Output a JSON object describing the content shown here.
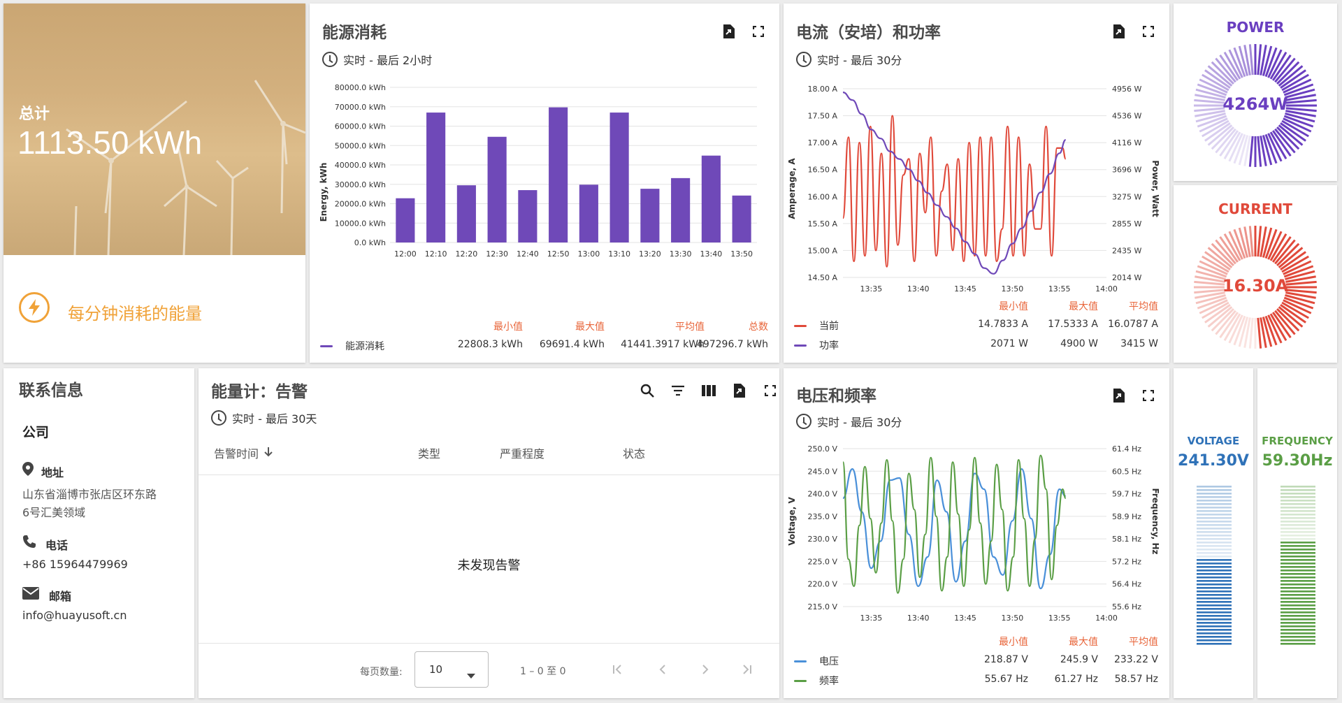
{
  "total_card": {
    "label": "总计",
    "value": "1113.50 kWh",
    "caption": "每分钟消耗的能量",
    "icon": "lightning-icon"
  },
  "energy_card": {
    "title": "能源消耗",
    "subtitle": "实时 - 最后 2小时",
    "ylabel": "Energy, kWh",
    "stat_headers": [
      "最小值",
      "最大值",
      "平均值",
      "总数"
    ],
    "legend_name": "能源消耗",
    "stats": [
      "22808.3 kWh",
      "69691.4 kWh",
      "41441.3917 kWh",
      "497296.7 kWh"
    ],
    "color": "#6f49b8"
  },
  "current_power_card": {
    "title": "电流（安培）和功率",
    "subtitle": "实时 - 最后 30分",
    "ylabel_left": "Amperage, A",
    "ylabel_right": "Power, Watt",
    "stat_headers": [
      "最小值",
      "最大值",
      "平均值"
    ],
    "series": [
      {
        "name": "当前",
        "color": "#e0493a",
        "stats": [
          "14.7833 A",
          "17.5333 A",
          "16.0787 A"
        ]
      },
      {
        "name": "功率",
        "color": "#6f49b8",
        "stats": [
          "2071 W",
          "4900 W",
          "3415 W"
        ]
      }
    ]
  },
  "power_gauge": {
    "title": "POWER",
    "value": "4264W",
    "color": "#6a3fc0",
    "fraction": 0.53
  },
  "current_gauge": {
    "title": "CURRENT",
    "value": "16.30A",
    "color": "#e0493a",
    "fraction": 0.5
  },
  "contact_card": {
    "title": "联系信息",
    "company": "公司",
    "address_label": "地址",
    "address_line1": "山东省淄博市张店区环东路",
    "address_line2": "6号汇美领域",
    "phone_label": "电话",
    "phone": "+86 15964479969",
    "email_label": "邮箱",
    "email": "info@huayusoft.cn"
  },
  "alarm_card": {
    "title": "能量计：告警",
    "subtitle": "实时 - 最后 30天",
    "columns": [
      "告警时间",
      "类型",
      "严重程度",
      "状态"
    ],
    "empty_text": "未发现告警",
    "page_size_label": "每页数量:",
    "page_size": "10",
    "range_text": "1 – 0 至 0"
  },
  "voltage_freq_card": {
    "title": "电压和频率",
    "subtitle": "实时 - 最后 30分",
    "ylabel_left": "Voltage, V",
    "ylabel_right": "Frequency, Hz",
    "stat_headers": [
      "最小值",
      "最大值",
      "平均值"
    ],
    "series": [
      {
        "name": "电压",
        "color": "#4a90d9",
        "stats": [
          "218.87 V",
          "245.9 V",
          "233.22 V"
        ]
      },
      {
        "name": "频率",
        "color": "#5a9e45",
        "stats": [
          "55.67 Hz",
          "61.27 Hz",
          "58.57 Hz"
        ]
      }
    ]
  },
  "voltage_gauge": {
    "title": "VOLTAGE",
    "value": "241.30V",
    "color": "#2f72b8",
    "fraction": 0.55
  },
  "frequency_gauge": {
    "title": "FREQUENCY",
    "value": "59.30Hz",
    "color": "#5a9e45",
    "fraction": 0.65
  },
  "chart_data": [
    {
      "type": "bar",
      "title": "能源消耗",
      "xlabel": "",
      "ylabel": "Energy, kWh",
      "categories": [
        "12:00",
        "12:10",
        "12:20",
        "12:30",
        "12:40",
        "12:50",
        "13:00",
        "13:10",
        "13:20",
        "13:30",
        "13:40",
        "13:50"
      ],
      "values": [
        22808,
        67000,
        29500,
        54500,
        27000,
        69691,
        29800,
        67000,
        27700,
        33200,
        44800,
        24200
      ],
      "yticks": [
        "0.0 kWh",
        "10000.0 kWh",
        "20000.0 kWh",
        "30000.0 kWh",
        "40000.0 kWh",
        "50000.0 kWh",
        "60000.0 kWh",
        "70000.0 kWh",
        "80000.0 kWh"
      ],
      "ylim": [
        0,
        80000
      ],
      "series": [
        {
          "name": "能源消耗",
          "values": [
            22808,
            67000,
            29500,
            54500,
            27000,
            69691,
            29800,
            67000,
            27700,
            33200,
            44800,
            24200
          ]
        }
      ]
    },
    {
      "type": "line",
      "title": "电流（安培）和功率",
      "xticks": [
        "13:35",
        "13:40",
        "13:45",
        "13:50",
        "13:55",
        "14:00"
      ],
      "yticks_left": [
        "14.50 A",
        "15.00 A",
        "15.50 A",
        "16.00 A",
        "16.50 A",
        "17.00 A",
        "17.50 A",
        "18.00 A"
      ],
      "yticks_right": [
        "2014 W",
        "2435 W",
        "2855 W",
        "3275 W",
        "3696 W",
        "4116 W",
        "4536 W",
        "4956 W"
      ],
      "ylim_left": [
        14.5,
        18.0
      ],
      "ylim_right": [
        2014,
        4956
      ],
      "x_range": [
        "13:32",
        "14:00"
      ],
      "series": [
        {
          "name": "当前",
          "axis": "left",
          "x": [
            "13:32:00",
            "13:32:35",
            "13:33:10",
            "13:33:45",
            "13:34:20",
            "13:34:55",
            "13:35:30",
            "13:36:05",
            "13:36:40",
            "13:37:15",
            "13:37:50",
            "13:38:25",
            "13:39:00",
            "13:39:35",
            "13:40:10",
            "13:40:45",
            "13:41:20",
            "13:41:55",
            "13:42:30",
            "13:43:05",
            "13:43:40",
            "13:44:15",
            "13:44:50",
            "13:45:25",
            "13:46:00",
            "13:46:35",
            "13:47:10",
            "13:47:45",
            "13:48:20",
            "13:48:55",
            "13:49:30",
            "13:50:05",
            "13:50:40",
            "13:51:15",
            "13:51:50",
            "13:52:25",
            "13:53:00",
            "13:53:35",
            "13:54:10",
            "13:54:45",
            "13:55:20",
            "13:55:40"
          ],
          "y": [
            15.6,
            17.1,
            14.8,
            17.0,
            14.9,
            17.3,
            15.0,
            16.8,
            14.7,
            17.5,
            15.1,
            16.4,
            16.7,
            14.8,
            16.8,
            15.7,
            17.1,
            14.9,
            16.1,
            16.6,
            15.0,
            16.7,
            14.8,
            17.0,
            14.9,
            17.1,
            14.9,
            17.1,
            14.8,
            15.4,
            17.3,
            14.9,
            17.1,
            14.9,
            16.6,
            15.4,
            15.4,
            17.3,
            14.9,
            16.9,
            16.9,
            16.7
          ]
        },
        {
          "name": "功率",
          "axis": "right",
          "x": [
            "13:32:00",
            "13:33:00",
            "13:34:00",
            "13:35:00",
            "13:36:00",
            "13:37:00",
            "13:38:00",
            "13:39:00",
            "13:40:00",
            "13:41:00",
            "13:42:00",
            "13:43:00",
            "13:44:00",
            "13:45:00",
            "13:46:00",
            "13:47:00",
            "13:48:00",
            "13:49:00",
            "13:50:00",
            "13:51:00",
            "13:52:00",
            "13:53:00",
            "13:54:00",
            "13:55:00",
            "13:55:40"
          ],
          "y": [
            4900,
            4780,
            4560,
            4320,
            4180,
            3980,
            3860,
            3700,
            3520,
            3330,
            3140,
            2960,
            2780,
            2570,
            2380,
            2160,
            2071,
            2280,
            2540,
            2780,
            3050,
            3340,
            3630,
            3950,
            4160
          ]
        }
      ]
    },
    {
      "type": "line",
      "title": "电压和频率",
      "xticks": [
        "13:35",
        "13:40",
        "13:45",
        "13:50",
        "13:55",
        "14:00"
      ],
      "yticks_left": [
        "215.0 V",
        "220.0 V",
        "225.0 V",
        "230.0 V",
        "235.0 V",
        "240.0 V",
        "245.0 V",
        "250.0 V"
      ],
      "yticks_right": [
        "55.6 Hz",
        "56.4 Hz",
        "57.2 Hz",
        "58.1 Hz",
        "58.9 Hz",
        "59.7 Hz",
        "60.5 Hz",
        "61.4 Hz"
      ],
      "ylim_left": [
        215,
        250
      ],
      "ylim_right": [
        55.6,
        61.4
      ],
      "x_range": [
        "13:32",
        "14:00"
      ],
      "series": [
        {
          "name": "电压",
          "axis": "left",
          "x": [
            "13:32:00",
            "13:33:00",
            "13:34:00",
            "13:35:00",
            "13:36:00",
            "13:37:00",
            "13:38:00",
            "13:39:00",
            "13:40:00",
            "13:41:00",
            "13:42:00",
            "13:43:00",
            "13:44:00",
            "13:45:00",
            "13:46:00",
            "13:47:00",
            "13:48:00",
            "13:49:00",
            "13:50:00",
            "13:51:00",
            "13:52:00",
            "13:53:00",
            "13:54:00",
            "13:55:00",
            "13:55:40"
          ],
          "y": [
            239.0,
            245.5,
            236.0,
            223.5,
            229.5,
            243.0,
            243.5,
            231.0,
            219.5,
            226.0,
            243.0,
            236.0,
            220.5,
            229.5,
            244.5,
            241.0,
            226.0,
            222.0,
            234.0,
            245.5,
            234.5,
            219.0,
            226.5,
            241.0,
            239.5
          ]
        },
        {
          "name": "频率",
          "axis": "left",
          "x": [
            "13:32:00",
            "13:32:35",
            "13:33:10",
            "13:33:45",
            "13:34:20",
            "13:34:55",
            "13:35:30",
            "13:36:05",
            "13:36:40",
            "13:37:15",
            "13:37:50",
            "13:38:25",
            "13:39:00",
            "13:39:35",
            "13:40:10",
            "13:40:45",
            "13:41:20",
            "13:41:55",
            "13:42:30",
            "13:43:05",
            "13:43:40",
            "13:44:15",
            "13:44:50",
            "13:45:25",
            "13:46:00",
            "13:46:35",
            "13:47:10",
            "13:47:45",
            "13:48:20",
            "13:48:55",
            "13:49:30",
            "13:50:05",
            "13:50:40",
            "13:51:15",
            "13:51:50",
            "13:52:25",
            "13:53:00",
            "13:53:35",
            "13:54:10",
            "13:54:45",
            "13:55:20",
            "13:55:40"
          ],
          "y": [
            247.0,
            225.5,
            219.5,
            233.0,
            246.0,
            234.5,
            222.5,
            233.5,
            247.5,
            234.0,
            218.0,
            225.5,
            244.5,
            236.5,
            221.5,
            231.0,
            248.0,
            235.0,
            218.5,
            226.0,
            247.0,
            235.5,
            219.5,
            232.0,
            248.0,
            233.5,
            220.0,
            229.5,
            246.5,
            236.5,
            218.5,
            226.0,
            247.5,
            234.5,
            219.5,
            230.0,
            248.5,
            241.0,
            221.0,
            233.0,
            241.0,
            239.0
          ]
        }
      ]
    }
  ]
}
